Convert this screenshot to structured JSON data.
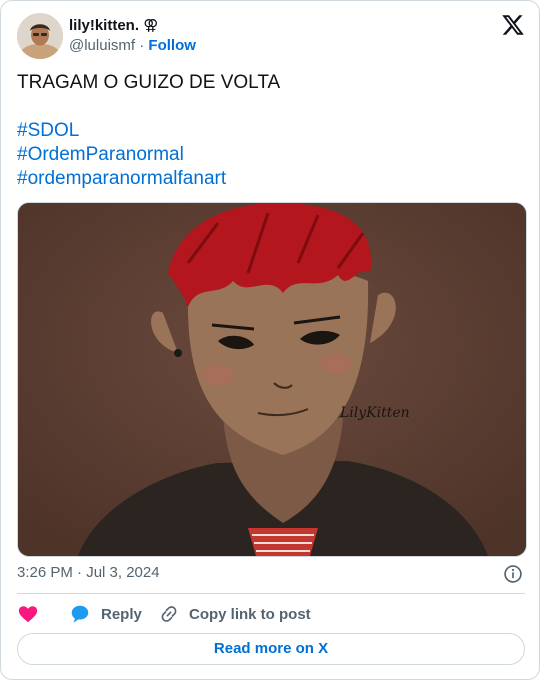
{
  "author": {
    "display_name": "lily!kitten.",
    "name_symbol": "⚢",
    "handle": "@luluismf",
    "separator": "·",
    "follow_label": "Follow"
  },
  "tweet": {
    "text": "TRAGAM O GUIZO DE VOLTA",
    "hashtags": [
      "#SDOL",
      "#OrdemParanormal",
      "#ordemparanormalfanart"
    ],
    "timestamp": "3:26 PM · Jul 3, 2024"
  },
  "media": {
    "signature": "LilyKitten"
  },
  "actions": {
    "reply_label": "Reply",
    "copy_label": "Copy link to post"
  },
  "read_more_label": "Read more on X",
  "colors": {
    "link": "#006fd6",
    "like": "#f91880",
    "reply_bubble": "#1d9bf0",
    "border": "#cfd9de",
    "muted": "#536471"
  }
}
